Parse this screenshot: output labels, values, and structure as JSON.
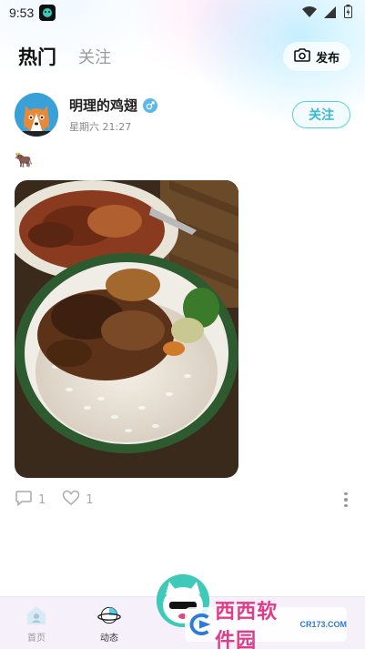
{
  "status_bar": {
    "time": "9:53"
  },
  "top_tabs": {
    "hot": "热门",
    "follow": "关注",
    "publish": "发布"
  },
  "post": {
    "user_name": "明理的鸡翅",
    "time": "星期六 21:27",
    "follow_label": "关注",
    "text": "🐂",
    "comment_count": "1",
    "like_count": "1"
  },
  "bottom_nav": {
    "home": "首页",
    "feed": "动态"
  },
  "watermark": {
    "text": "西西软件园",
    "url": "CR173.COM"
  },
  "colors": {
    "accent": "#37b8d6",
    "nav_bg": "#f6f0fa"
  },
  "icons": [
    "camera-icon",
    "gender-male-icon",
    "comment-icon",
    "heart-icon",
    "more-icon",
    "home-icon",
    "planet-icon"
  ]
}
